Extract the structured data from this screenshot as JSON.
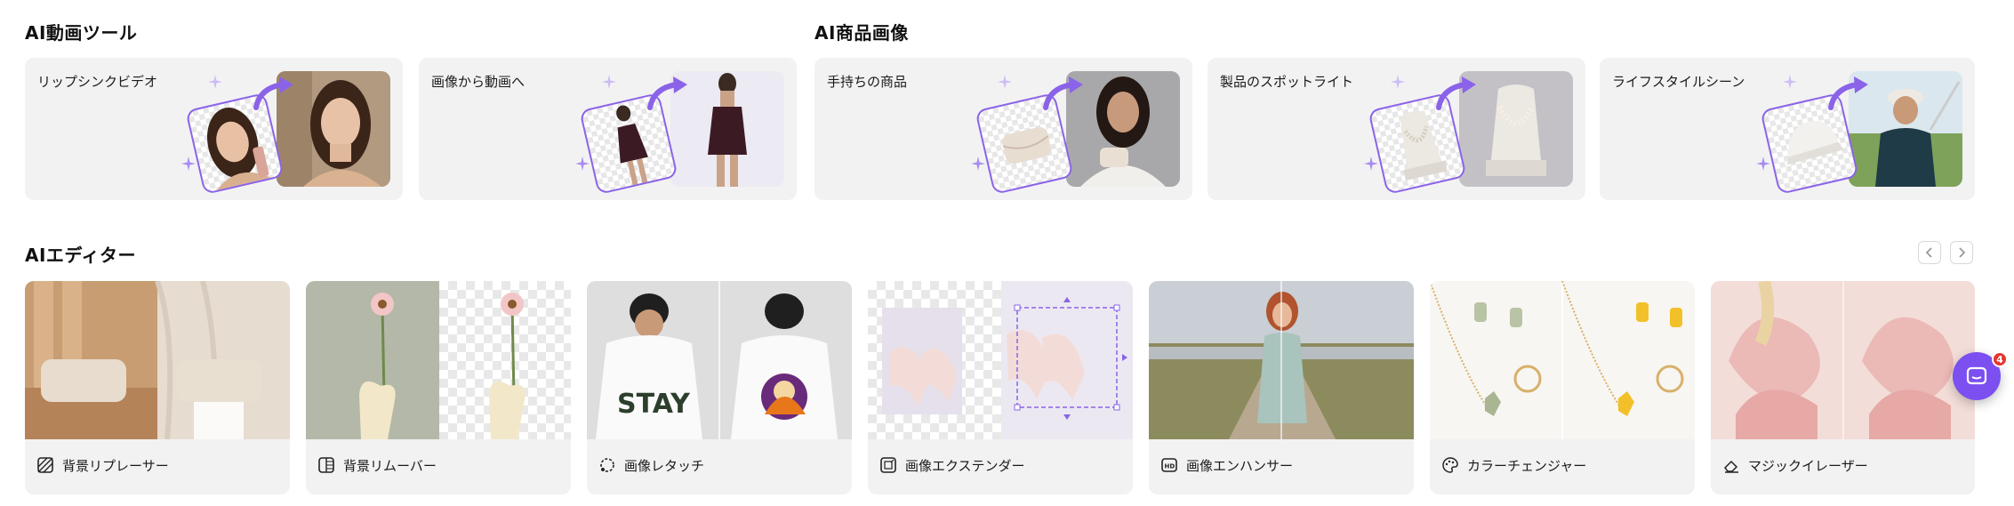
{
  "sections": {
    "video_tools": "AI動画ツール",
    "product_images": "AI商品画像",
    "editor": "AIエディター"
  },
  "feature_cards": [
    {
      "label": "リップシンクビデオ"
    },
    {
      "label": "画像から動画へ"
    },
    {
      "label": "手持ちの商品"
    },
    {
      "label": "製品のスポットライト"
    },
    {
      "label": "ライフスタイルシーン"
    }
  ],
  "editor_cards": [
    {
      "label": "背景リプレーサー",
      "icon": "background-replace-icon"
    },
    {
      "label": "背景リムーバー",
      "icon": "background-remove-icon"
    },
    {
      "label": "画像レタッチ",
      "icon": "retouch-icon"
    },
    {
      "label": "画像エクステンダー",
      "icon": "extend-icon"
    },
    {
      "label": "画像エンハンサー",
      "icon": "hd-icon"
    },
    {
      "label": "カラーチェンジャー",
      "icon": "palette-icon"
    },
    {
      "label": "マジックイレーザー",
      "icon": "eraser-icon"
    }
  ],
  "chat": {
    "badge": "4"
  },
  "colors": {
    "accent": "#8a63e8",
    "card_bg": "#f2f2f3",
    "badge": "#e5342f"
  }
}
